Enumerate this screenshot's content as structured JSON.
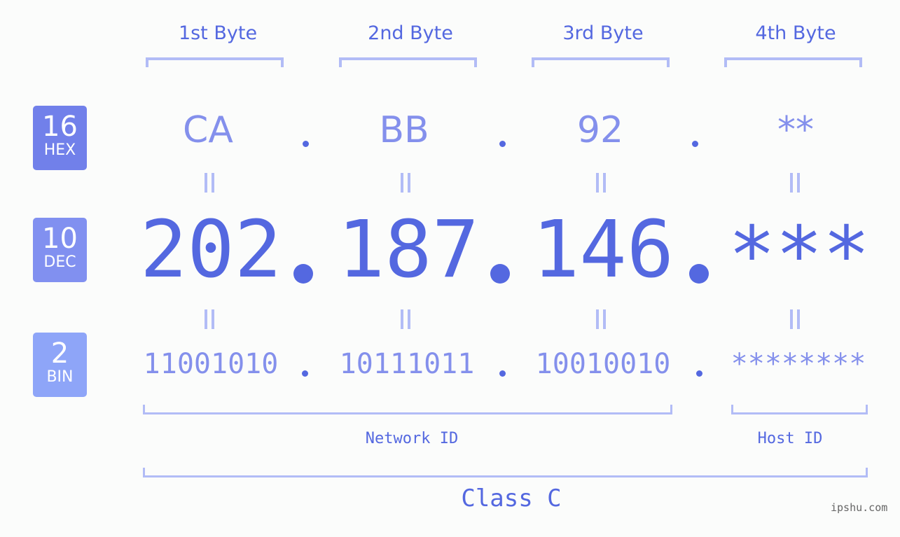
{
  "bytes": [
    {
      "label": "1st Byte",
      "hex": "CA",
      "dec": "202",
      "bin": "11001010"
    },
    {
      "label": "2nd Byte",
      "hex": "BB",
      "dec": "187",
      "bin": "10111011"
    },
    {
      "label": "3rd Byte",
      "hex": "92",
      "dec": "146",
      "bin": "10010010"
    },
    {
      "label": "4th Byte",
      "hex": "**",
      "dec": "***",
      "bin": "********"
    }
  ],
  "rows": {
    "hex": {
      "base": "16",
      "name": "HEX",
      "color": "#7180ea"
    },
    "dec": {
      "base": "10",
      "name": "DEC",
      "color": "#8190f0"
    },
    "bin": {
      "base": "2",
      "name": "BIN",
      "color": "#8ea5f8"
    }
  },
  "separator": ".",
  "segments": {
    "network": "Network ID",
    "host": "Host ID",
    "class": "Class C"
  },
  "watermark": "ipshu.com",
  "colors": {
    "accent": "#5468e0",
    "light_value": "#8490ec",
    "bracket": "#b2bcf6"
  }
}
